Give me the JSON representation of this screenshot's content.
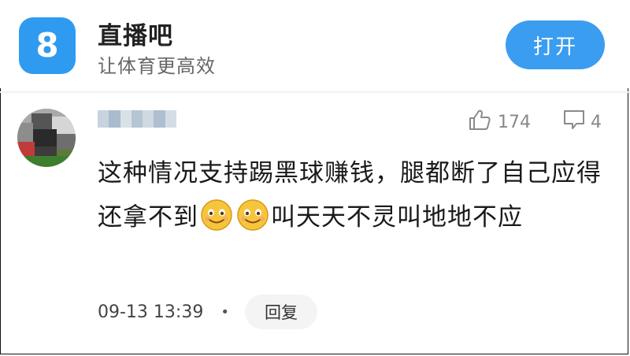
{
  "header": {
    "logo_glyph": "8",
    "app_name": "直播吧",
    "slogan": "让体育更高效",
    "open_button_label": "打开",
    "accent_color": "#3a9df0"
  },
  "comment": {
    "username_obscured": true,
    "like_count": "174",
    "reply_count": "4",
    "text_part1": "这种情况支持踢黑球赚钱，腿都断了自己应得还拿不到",
    "emoji_name": "smiling-face-emoji",
    "emoji_count": 2,
    "text_part2": "叫天天不灵叫地地不应",
    "timestamp": "09-13 13:39",
    "separator": "•",
    "reply_button_label": "回复"
  }
}
